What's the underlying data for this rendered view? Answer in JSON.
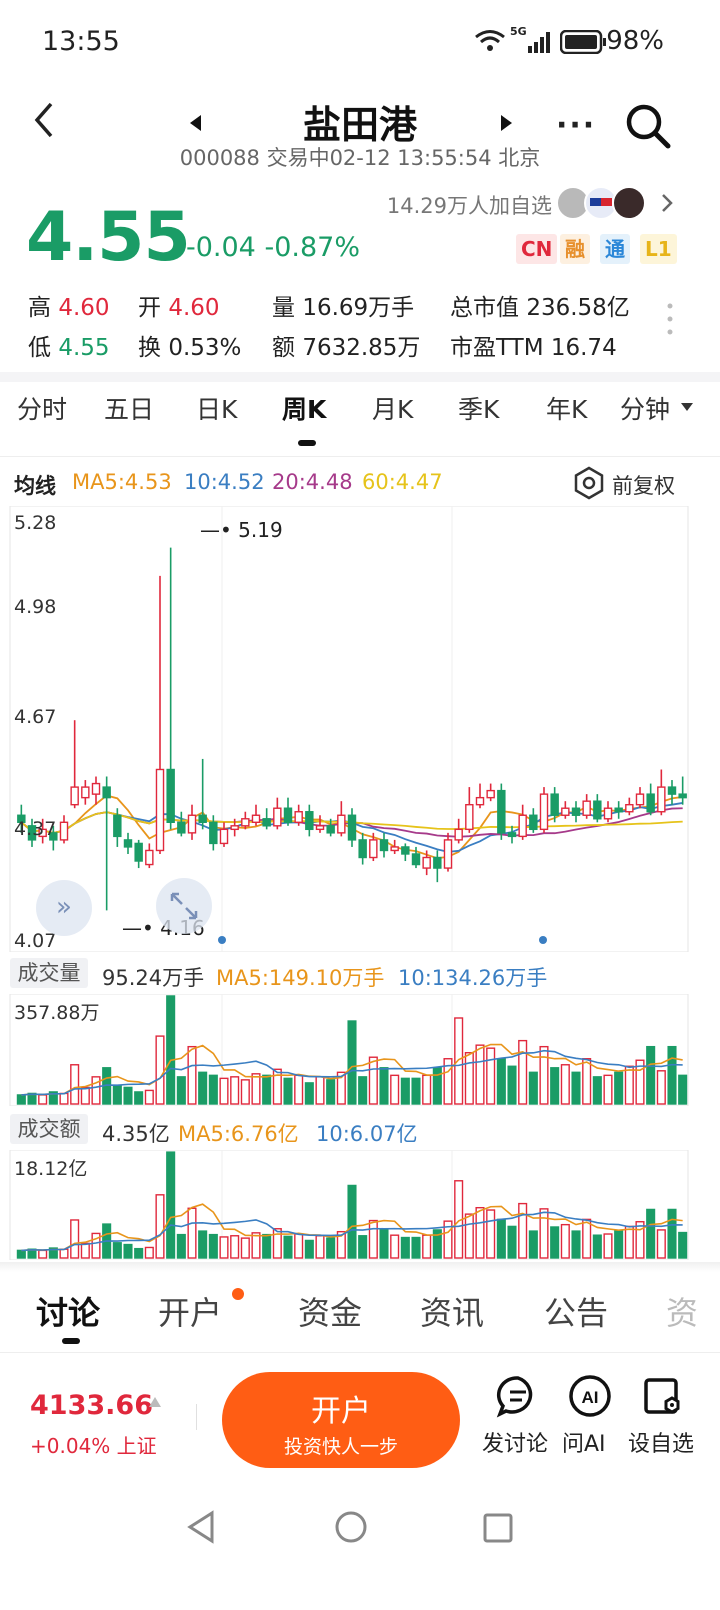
{
  "status_bar": {
    "time": "13:55",
    "network": "5G",
    "battery": "98%"
  },
  "header": {
    "title": "盐田港",
    "subtitle": "000088 交易中02-12 13:55:54 北京"
  },
  "quote": {
    "price": "4.55",
    "change": "-0.04",
    "change_pct": "-0.87%",
    "watchers": "14.29万人加自选",
    "badges": [
      "CN",
      "融",
      "通",
      "L1"
    ],
    "high_label": "高",
    "high": "4.60",
    "open_label": "开",
    "open": "4.60",
    "low_label": "低",
    "low": "4.55",
    "turnover_label": "换",
    "turnover": "0.53%",
    "volume_label": "量",
    "volume": "16.69万手",
    "amount_label": "额",
    "amount": "7632.85万",
    "mktcap_label": "总市值",
    "mktcap": "236.58亿",
    "pe_label": "市盈TTM",
    "pe": "16.74"
  },
  "period_tabs": [
    "分时",
    "五日",
    "日K",
    "周K",
    "月K",
    "季K",
    "年K",
    "分钟"
  ],
  "active_period": "周K",
  "ma_legend": {
    "label": "均线",
    "ma5": "MA5:4.53",
    "ma10": "10:4.52",
    "ma20": "20:4.48",
    "ma60": "60:4.47",
    "adjust": "前复权"
  },
  "colors": {
    "up": "#e0283c",
    "down": "#1a9c66",
    "ma5": "#e8951b",
    "ma10": "#3a7ec2",
    "ma20": "#a63a8a",
    "ma60": "#e6c31a",
    "accent": "#ff5d14"
  },
  "chart_data": [
    {
      "type": "candlestick",
      "y_ticks": [
        "5.28",
        "4.98",
        "4.67",
        "4.37",
        "4.07"
      ],
      "ylim": [
        4.07,
        5.28
      ],
      "max_marker": "5.19",
      "min_marker": "4.16",
      "candles": [
        [
          4.43,
          4.41,
          4.46,
          4.38
        ],
        [
          4.4,
          4.36,
          4.42,
          4.34
        ],
        [
          4.37,
          4.39,
          4.42,
          4.35
        ],
        [
          4.38,
          4.36,
          4.4,
          4.33
        ],
        [
          4.36,
          4.41,
          4.43,
          4.35
        ],
        [
          4.46,
          4.51,
          4.7,
          4.45
        ],
        [
          4.48,
          4.51,
          4.53,
          4.46
        ],
        [
          4.49,
          4.52,
          4.54,
          4.46
        ],
        [
          4.51,
          4.48,
          4.54,
          4.16
        ],
        [
          4.43,
          4.37,
          4.45,
          4.34
        ],
        [
          4.36,
          4.34,
          4.38,
          4.32
        ],
        [
          4.35,
          4.3,
          4.36,
          4.28
        ],
        [
          4.29,
          4.33,
          4.35,
          4.28
        ],
        [
          4.33,
          4.56,
          5.11,
          4.32
        ],
        [
          4.56,
          4.41,
          5.19,
          4.39
        ],
        [
          4.41,
          4.38,
          4.44,
          4.37
        ],
        [
          4.38,
          4.43,
          4.46,
          4.36
        ],
        [
          4.43,
          4.41,
          4.59,
          4.39
        ],
        [
          4.41,
          4.35,
          4.43,
          4.33
        ],
        [
          4.35,
          4.39,
          4.41,
          4.34
        ],
        [
          4.39,
          4.4,
          4.42,
          4.37
        ],
        [
          4.4,
          4.42,
          4.44,
          4.39
        ],
        [
          4.41,
          4.43,
          4.46,
          4.4
        ],
        [
          4.42,
          4.4,
          4.45,
          4.39
        ],
        [
          4.4,
          4.45,
          4.48,
          4.39
        ],
        [
          4.45,
          4.41,
          4.48,
          4.4
        ],
        [
          4.41,
          4.44,
          4.46,
          4.4
        ],
        [
          4.44,
          4.39,
          4.46,
          4.37
        ],
        [
          4.39,
          4.4,
          4.43,
          4.38
        ],
        [
          4.4,
          4.38,
          4.42,
          4.37
        ],
        [
          4.38,
          4.43,
          4.47,
          4.37
        ],
        [
          4.43,
          4.36,
          4.45,
          4.34
        ],
        [
          4.36,
          4.31,
          4.38,
          4.29
        ],
        [
          4.31,
          4.36,
          4.38,
          4.3
        ],
        [
          4.36,
          4.33,
          4.38,
          4.31
        ],
        [
          4.33,
          4.34,
          4.36,
          4.32
        ],
        [
          4.34,
          4.32,
          4.35,
          4.3
        ],
        [
          4.32,
          4.29,
          4.34,
          4.28
        ],
        [
          4.28,
          4.31,
          4.33,
          4.26
        ],
        [
          4.31,
          4.28,
          4.33,
          4.24
        ],
        [
          4.28,
          4.36,
          4.38,
          4.27
        ],
        [
          4.36,
          4.39,
          4.42,
          4.35
        ],
        [
          4.39,
          4.46,
          4.51,
          4.38
        ],
        [
          4.46,
          4.48,
          4.52,
          4.45
        ],
        [
          4.48,
          4.5,
          4.52,
          4.47
        ],
        [
          4.5,
          4.38,
          4.52,
          4.36
        ],
        [
          4.38,
          4.37,
          4.4,
          4.35
        ],
        [
          4.37,
          4.43,
          4.46,
          4.36
        ],
        [
          4.43,
          4.39,
          4.45,
          4.38
        ],
        [
          4.39,
          4.49,
          4.51,
          4.38
        ],
        [
          4.49,
          4.43,
          4.51,
          4.41
        ],
        [
          4.43,
          4.45,
          4.47,
          4.42
        ],
        [
          4.45,
          4.43,
          4.47,
          4.41
        ],
        [
          4.43,
          4.47,
          4.49,
          4.42
        ],
        [
          4.47,
          4.42,
          4.49,
          4.41
        ],
        [
          4.42,
          4.45,
          4.47,
          4.41
        ],
        [
          4.45,
          4.44,
          4.47,
          4.42
        ],
        [
          4.44,
          4.46,
          4.48,
          4.43
        ],
        [
          4.46,
          4.49,
          4.51,
          4.45
        ],
        [
          4.49,
          4.44,
          4.52,
          4.43
        ],
        [
          4.44,
          4.51,
          4.56,
          4.43
        ],
        [
          4.51,
          4.49,
          4.53,
          4.46
        ],
        [
          4.49,
          4.48,
          4.54,
          4.46
        ]
      ]
    },
    {
      "type": "bar",
      "label": "成交量",
      "value": "95.24万手",
      "ma5": "MA5:149.10万手",
      "ma10": "10:134.26万手",
      "y_max_label": "357.88万",
      "ylim": [
        0,
        357.88
      ],
      "values": [
        30,
        35,
        30,
        40,
        35,
        130,
        55,
        90,
        120,
        60,
        55,
        40,
        45,
        225,
        358,
        90,
        190,
        105,
        95,
        85,
        90,
        80,
        100,
        95,
        115,
        85,
        95,
        70,
        90,
        80,
        105,
        275,
        90,
        155,
        120,
        95,
        85,
        85,
        95,
        120,
        150,
        285,
        170,
        195,
        185,
        150,
        125,
        210,
        105,
        190,
        120,
        130,
        105,
        150,
        90,
        95,
        105,
        125,
        145,
        190,
        110,
        190,
        95
      ]
    },
    {
      "type": "bar",
      "label": "成交额",
      "value": "4.35亿",
      "ma5": "MA5:6.76亿",
      "ma10": "10:6.07亿",
      "y_max_label": "18.12亿",
      "ylim": [
        0,
        18.12
      ],
      "values": [
        1.3,
        1.5,
        1.3,
        1.7,
        1.5,
        6.5,
        2.5,
        4.2,
        5.8,
        2.6,
        2.3,
        1.6,
        1.8,
        10.8,
        18.1,
        4.0,
        8.5,
        4.6,
        4.0,
        3.6,
        3.8,
        3.4,
        4.3,
        4.0,
        5.0,
        3.7,
        4.1,
        3.0,
        3.8,
        3.4,
        4.5,
        12.4,
        3.8,
        6.4,
        4.9,
        3.9,
        3.5,
        3.5,
        3.9,
        4.8,
        6.3,
        13.2,
        7.5,
        8.6,
        8.2,
        6.6,
        5.4,
        9.3,
        4.6,
        8.4,
        5.3,
        5.7,
        4.6,
        6.6,
        3.9,
        4.1,
        4.6,
        5.4,
        6.2,
        8.3,
        4.8,
        8.3,
        4.35
      ]
    }
  ],
  "bottom_tabs": [
    "讨论",
    "开户",
    "资金",
    "资讯",
    "公告",
    "资"
  ],
  "footer": {
    "index_value": "4133.66",
    "index_change": "+0.04% 上证",
    "open_btn": "开户",
    "open_sub": "投资快人一步",
    "actions": [
      "发讨论",
      "问AI",
      "设自选"
    ]
  }
}
